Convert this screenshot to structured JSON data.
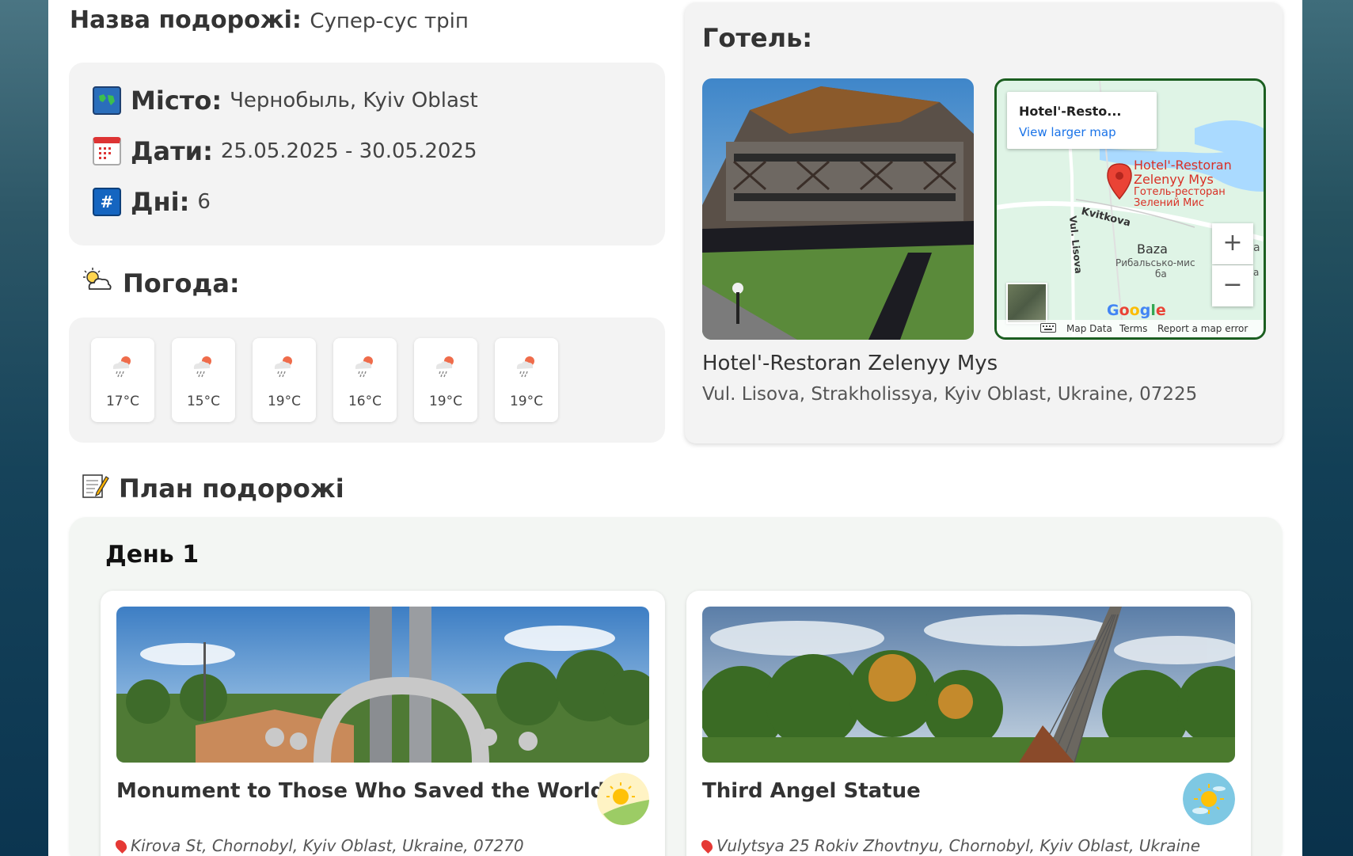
{
  "trip": {
    "name_label": "Назва подорожі:",
    "name_value": "Супер-сус тріп"
  },
  "info": {
    "city_label": "Місто:",
    "city_value": "Чернобыль, Kyiv Oblast",
    "dates_label": "Дати:",
    "dates_value": "25.05.2025 - 30.05.2025",
    "days_label": "Дні:",
    "days_value": "6",
    "hash_icon": "#"
  },
  "weather": {
    "title": "Погода:",
    "icon": "sun-behind-cloud-icon",
    "days": [
      {
        "temp": "17°C",
        "icon": "rain-cloud-sun-icon"
      },
      {
        "temp": "15°C",
        "icon": "rain-cloud-sun-icon"
      },
      {
        "temp": "19°C",
        "icon": "rain-cloud-sun-icon"
      },
      {
        "temp": "16°C",
        "icon": "rain-cloud-sun-icon"
      },
      {
        "temp": "19°C",
        "icon": "rain-cloud-sun-icon"
      },
      {
        "temp": "19°C",
        "icon": "rain-cloud-sun-icon"
      }
    ]
  },
  "hotel": {
    "title": "Готель:",
    "name": "Hotel'-Restoran Zelenyy Mys",
    "address": "Vul. Lisova, Strakholissya, Kyiv Oblast, Ukraine, 07225",
    "map": {
      "card_title": "Hotel'-Resto...",
      "card_link": "View larger map",
      "pin_label_1": "Hotel'-Restoran",
      "pin_label_2": "Zelenyy Mys",
      "pin_label_3": "Готель-ресторан",
      "pin_label_4": "Зелений Мис",
      "street_1": "Kvitkova",
      "street_2": "Vul. Lisova",
      "poi_1": "Baza",
      "poi_2": "Рибальсько-мис",
      "poi_3": "ба",
      "poi_edge_1": "а",
      "poi_edge_2": "а",
      "zoom_in": "+",
      "zoom_out": "−",
      "footer_data": "Map Data",
      "footer_terms": "Terms",
      "footer_report": "Report a map error",
      "google": [
        "G",
        "o",
        "o",
        "g",
        "l",
        "e"
      ],
      "google_colors": [
        "#4285F4",
        "#EA4335",
        "#FBBC05",
        "#4285F4",
        "#34A853",
        "#EA4335"
      ]
    }
  },
  "plan": {
    "title": "План подорожі",
    "day_title": "День 1",
    "places": [
      {
        "name": "Monument to Those Who Saved the World",
        "address": "Kirova St, Chornobyl, Kyiv Oblast, Ukraine, 07270",
        "weather_icon": "sunny-hill-icon"
      },
      {
        "name": "Third Angel Statue",
        "address": "Vulytsya 25 Rokiv Zhovtnyu, Chornobyl, Kyiv Oblast, Ukraine",
        "weather_icon": "sun-icon"
      }
    ]
  },
  "colors": {
    "map_border": "#1b5e20",
    "link": "#1a73e8",
    "pin": "#e53935"
  }
}
